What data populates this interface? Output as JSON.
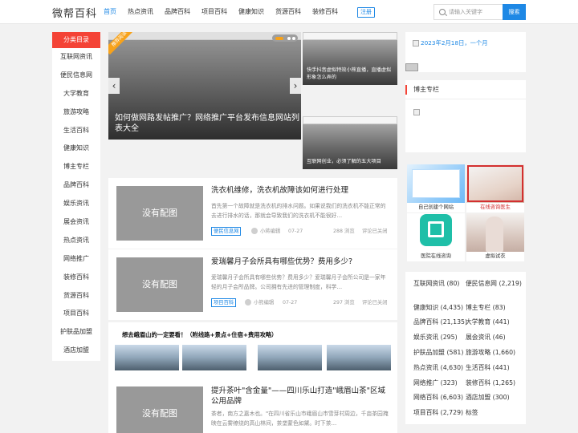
{
  "header": {
    "logo": "微帮百科",
    "nav": [
      "首页",
      "热点资讯",
      "品牌百科",
      "项目百科",
      "健康知识",
      "货源百科",
      "装修百科"
    ],
    "active_nav": 0,
    "register_label": "注册",
    "search_placeholder": "请输入关键字",
    "search_button": "搜索"
  },
  "sidebar": {
    "title": "分类目录",
    "items": [
      "互联网资讯",
      "便民信息网",
      "大学教育",
      "旅游攻略",
      "生活百科",
      "健康知识",
      "博主专栏",
      "品牌百科",
      "娱乐资讯",
      "展会资讯",
      "热点资讯",
      "网络推广",
      "装修百科",
      "货源百科",
      "项目百科",
      "护肤品加盟",
      "酒店加盟"
    ]
  },
  "slider": {
    "ribbon": "推荐阅读",
    "caption": "如何做网路发帖推广？网络推广平台发布信息网站列表大全",
    "prev": "‹",
    "next": "›"
  },
  "side_cards": [
    {
      "caption": "快手抖音虚拟特效小熊直播，直播虚拟形象怎么弄的"
    },
    {
      "caption": "互联网创业，必须了解的五大项目"
    }
  ],
  "articles": [
    {
      "thumb": "没有配图",
      "title": "洗衣机维修，洗衣机故障该如何进行处理",
      "excerpt": "首先第一个故障就是洗衣机的排水问题。如果说我们的洗衣机不能正常的去进行排水的话，那就会导致我们的洗衣机不能很好…",
      "tag": "便民信息网",
      "author": "小蒋编辑",
      "date": "07-27",
      "views": "288 浏览",
      "comments": "评论已关闭"
    },
    {
      "thumb": "没有配图",
      "title": "爱瑞馨月子会所具有哪些优势？费用多少?",
      "excerpt": "爱瑞馨月子会所具有哪些优势？费用多少？爱瑞馨月子会所公司是一家年轻的月子会所品牌。公司拥有先进的管理制度，科学…",
      "tag": "项目百科",
      "author": "小熊编辑",
      "date": "07-27",
      "views": "297 浏览",
      "comments": "评论已关闭"
    },
    {
      "thumb": "没有配图",
      "title": "提升茶叶\"含金量\"——四川乐山打造\"峨眉山茶\"区域公用品牌",
      "excerpt": "茶者，南方之嘉木也。\"在四川省乐山市峨眉山市雪芽村周边，千亩茶园掩映在云雾缭绕的高山林间，茶垄蒙色如黛。时下茶…",
      "tag": "",
      "author": "",
      "date": "",
      "views": "",
      "comments": ""
    }
  ],
  "banner": {
    "title": "想去峨眉山的一定要看！（附线路+景点+住宿+费用攻略）"
  },
  "right": {
    "top_link": "2023年2月18日，一个月",
    "section_title": "博主专栏",
    "tiles": [
      {
        "label": "自己创建个网站",
        "red": false
      },
      {
        "label": "在线咨询医生",
        "red": true
      },
      {
        "label": "医院在线咨询",
        "red": false
      },
      {
        "label": "虚拟试衣",
        "red": false
      }
    ],
    "categories": [
      [
        "互联网资讯 (80)",
        "便民信息网 (2,219)"
      ],
      [
        "健康知识 (4,435)",
        "博主专栏 (83)"
      ],
      [
        "品牌百科 (21,135)",
        "大学教育 (441)"
      ],
      [
        "娱乐资讯 (295)",
        "展会资讯 (46)"
      ],
      [
        "护肤品加盟 (581)",
        "旅游攻略 (1,660)"
      ],
      [
        "热点资讯 (4,630)",
        "生活百科 (441)"
      ],
      [
        "网络推广 (323)",
        "装修百科 (1,265)"
      ],
      [
        "网络百科 (6,603)",
        "酒店加盟 (300)"
      ],
      [
        "项目百科 (2,729)",
        "标签"
      ]
    ]
  }
}
